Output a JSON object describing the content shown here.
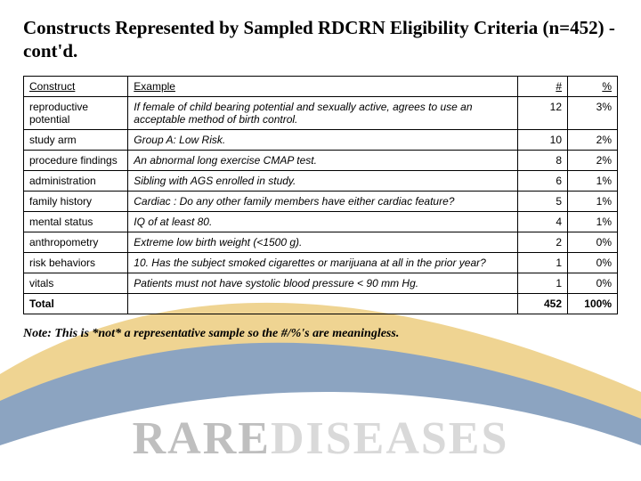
{
  "title": "Constructs Represented by Sampled RDCRN Eligibility Criteria (n=452)  - cont'd.",
  "columns": {
    "construct": "Construct",
    "example": "Example",
    "count": "#",
    "pct": "%"
  },
  "rows": [
    {
      "construct": "reproductive potential",
      "example": "If female of child bearing potential and sexually active, agrees to use an acceptable method of birth control.",
      "count": "12",
      "pct": "3%"
    },
    {
      "construct": "study arm",
      "example": "Group A: Low Risk.",
      "count": "10",
      "pct": "2%"
    },
    {
      "construct": "procedure findings",
      "example": "An abnormal long exercise CMAP test.",
      "count": "8",
      "pct": "2%"
    },
    {
      "construct": "administration",
      "example": "Sibling with AGS enrolled in study.",
      "count": "6",
      "pct": "1%"
    },
    {
      "construct": "family history",
      "example": "Cardiac : Do any other family members have either cardiac feature?",
      "count": "5",
      "pct": "1%"
    },
    {
      "construct": "mental status",
      "example": "IQ of at least 80.",
      "count": "4",
      "pct": "1%"
    },
    {
      "construct": "anthropometry",
      "example": "Extreme low birth weight (<1500 g).",
      "count": "2",
      "pct": "0%"
    },
    {
      "construct": "risk behaviors",
      "example": "10. Has the subject smoked cigarettes or marijuana at all in the prior year?",
      "count": "1",
      "pct": "0%"
    },
    {
      "construct": "vitals",
      "example": "Patients must not have systolic blood pressure < 90 mm Hg.",
      "count": "1",
      "pct": "0%"
    }
  ],
  "total": {
    "label": "Total",
    "count": "452",
    "pct": "100%"
  },
  "footnote": "Note: This is *not* a representative sample so the #/%'s are meaningless.",
  "watermark": {
    "a": "RARE",
    "b": "DISEASES"
  }
}
